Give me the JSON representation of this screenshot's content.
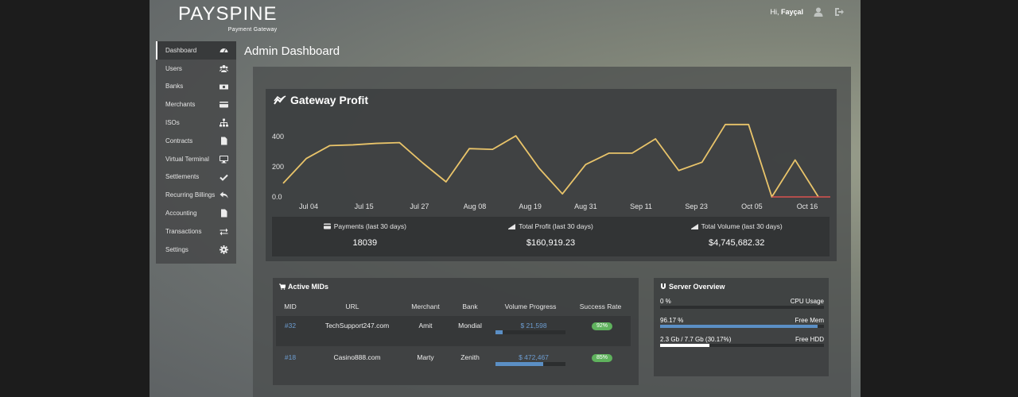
{
  "header": {
    "logo": "PAYSPINE",
    "logo_sub": "Payment Gateway",
    "greeting": "Hi,",
    "user_name": "Fayçal"
  },
  "sidebar": {
    "items": [
      {
        "label": "Dashboard",
        "icon": "dashboard-icon",
        "active": true
      },
      {
        "label": "Users",
        "icon": "users-icon"
      },
      {
        "label": "Banks",
        "icon": "money-icon"
      },
      {
        "label": "Merchants",
        "icon": "credit-card-icon"
      },
      {
        "label": "ISOs",
        "icon": "sitemap-icon"
      },
      {
        "label": "Contracts",
        "icon": "file-icon"
      },
      {
        "label": "Virtual Terminal",
        "icon": "desktop-icon"
      },
      {
        "label": "Settlements",
        "icon": "check-icon"
      },
      {
        "label": "Recurring Billings",
        "icon": "reply-icon"
      },
      {
        "label": "Accounting",
        "icon": "file-icon"
      },
      {
        "label": "Transactions",
        "icon": "exchange-icon"
      },
      {
        "label": "Settings",
        "icon": "gear-icon"
      }
    ]
  },
  "page_title": "Admin Dashboard",
  "profit": {
    "title": "Gateway Profit",
    "stats": [
      {
        "label": "Payments (last 30 days)",
        "value": "18039",
        "icon": "credit-card-icon"
      },
      {
        "label": "Total Profit (last 30 days)",
        "value": "$160,919.23",
        "icon": "area-chart-icon"
      },
      {
        "label": "Total Volume (last 30 days)",
        "value": "$4,745,682.32",
        "icon": "area-chart-icon"
      }
    ]
  },
  "chart_data": {
    "type": "line",
    "title": "",
    "ylabel": "",
    "xlabel": "",
    "ylim": [
      0,
      500
    ],
    "y_ticks": [
      "0.0",
      "200",
      "400"
    ],
    "x_ticks": [
      "Jul 04",
      "Jul 15",
      "Jul 27",
      "Aug 08",
      "Aug 19",
      "Aug 31",
      "Sep 11",
      "Sep 23",
      "Oct 05",
      "Oct 16"
    ],
    "series": [
      {
        "color": "#e9c46a",
        "values": [
          90,
          255,
          340,
          345,
          355,
          360,
          225,
          100,
          320,
          315,
          405,
          190,
          20,
          215,
          290,
          290,
          385,
          175,
          230,
          480,
          480,
          0,
          245,
          0
        ]
      },
      {
        "color": "#d9534f",
        "values": [
          0,
          0
        ]
      }
    ]
  },
  "mids": {
    "title": "Active MIDs",
    "columns": [
      "MID",
      "URL",
      "Merchant",
      "Bank",
      "Volume Progress",
      "Success Rate"
    ],
    "rows": [
      {
        "mid": "#32",
        "url": "TechSupport247.com",
        "merchant": "Amit",
        "bank": "Mondial",
        "volume": "$ 21,598",
        "progress": 0.1,
        "rate": "92%"
      },
      {
        "mid": "#18",
        "url": "Casino888.com",
        "merchant": "Marty",
        "bank": "Zenith",
        "volume": "$ 472,467",
        "progress": 0.68,
        "rate": "85%"
      }
    ]
  },
  "server": {
    "title": "Server Overview",
    "rows": [
      {
        "left": "0 %",
        "right": "CPU Usage",
        "fill": 0.0,
        "color": "#5b8fc5"
      },
      {
        "left": "96.17 %",
        "right": "Free Mem",
        "fill": 0.9617,
        "color": "#5b8fc5"
      },
      {
        "left": "2.3 Gb / 7.7 Gb (30.17%)",
        "right": "Free HDD",
        "fill": 0.3017,
        "color": "#ffffff"
      }
    ]
  }
}
